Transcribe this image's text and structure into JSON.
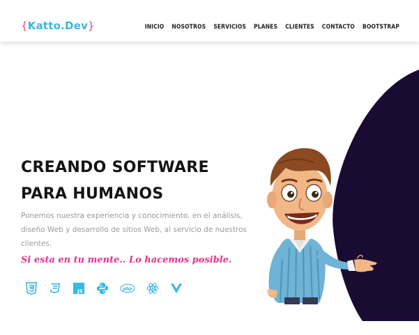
{
  "brand": {
    "brace_open": "{",
    "name": "Katto.Dev",
    "brace_close": "}",
    "brace_color": "#e83e8c",
    "name_color": "#3ab7e3"
  },
  "nav": {
    "items": [
      {
        "label": "INICIO"
      },
      {
        "label": "NOSOTROS"
      },
      {
        "label": "SERVICIOS"
      },
      {
        "label": "PLANES"
      },
      {
        "label": "CLIENTES"
      },
      {
        "label": "CONTACTO"
      },
      {
        "label": "BOOTSTRAP"
      }
    ]
  },
  "hero": {
    "title": "CREANDO SOFTWARE PARA HUMANOS",
    "description": "Ponemos nuestra experiencia y conocimiento, en el análisis, diseño Web y desarrollo de sitios Web, al servicio de nuestros clientes.",
    "slogan": "Si esta en tu mente.. Lo hacemos posible.",
    "accent_color": "#e5338d",
    "dark_shape_color": "#1a0b33"
  },
  "tech_icons": [
    "html5-icon",
    "css3-icon",
    "javascript-icon",
    "python-icon",
    "php-icon",
    "react-icon",
    "vue-icon"
  ],
  "tech_icon_text": {
    "js": "JS",
    "php": "php"
  },
  "colors": {
    "icon_blue": "#3ab7e3",
    "title": "#141414",
    "muted_text": "#9a9a9a"
  }
}
